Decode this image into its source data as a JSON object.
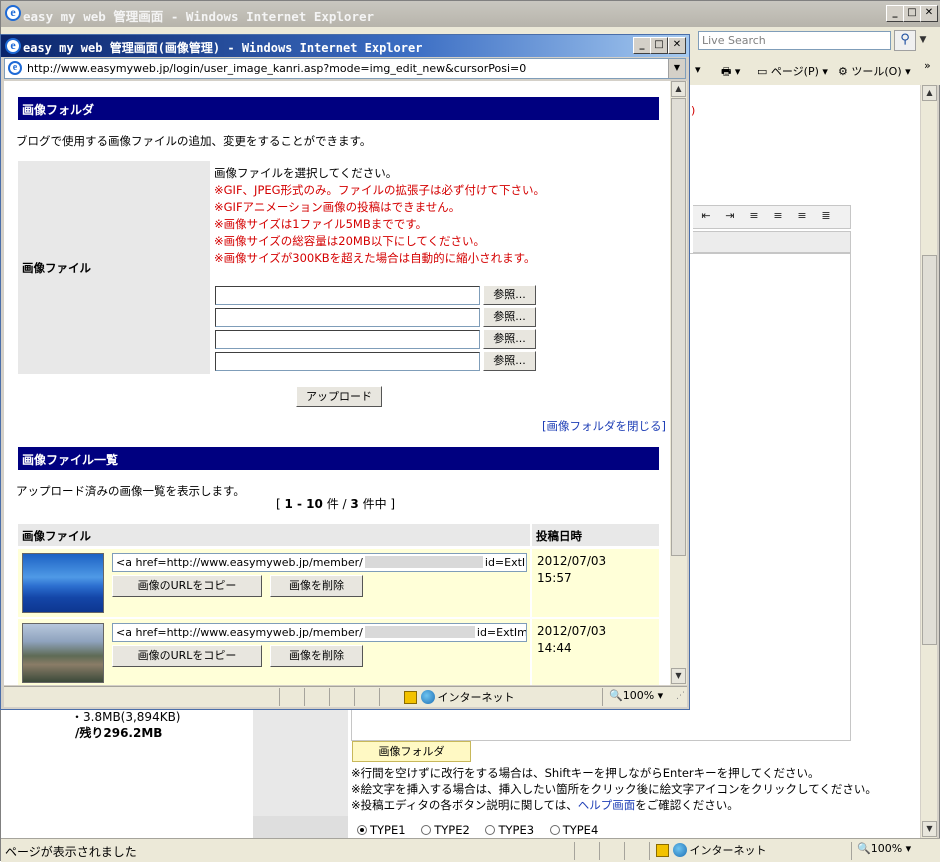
{
  "bg_window": {
    "title": "easy my web 管理画面 - Windows Internet Explorer",
    "search_placeholder": "Live Search",
    "cmd_page": "ページ(P)",
    "cmd_tools": "ツール(O)",
    "red_fragment": ")",
    "capacity": "・3.8MB(3,894KB)",
    "remaining": "/残り296.2MB",
    "folder_button": "画像フォルダ",
    "note1": "※行間を空けずに改行をする場合は、Shiftキーを押しながらEnterキーを押してください。",
    "note2": "※絵文字を挿入する場合は、挿入したい箇所をクリック後に絵文字アイコンをクリックしてください。",
    "note3_pre": "※投稿エディタの各ボタン説明に関しては、",
    "note3_link": "ヘルプ画面",
    "note3_post": "をご確認ください。",
    "types": [
      "TYPE1",
      "TYPE2",
      "TYPE3",
      "TYPE4"
    ],
    "status_text": "ページが表示されました",
    "status_zone": "インターネット",
    "status_zoom": "100%"
  },
  "popup": {
    "title": "easy my web 管理画面(画像管理) - Windows Internet Explorer",
    "url": "http://www.easymyweb.jp/login/user_image_kanri.asp?mode=img_edit_new&cursorPosi=0",
    "folder_header": "画像フォルダ",
    "folder_desc": "ブログで使用する画像ファイルの追加、変更をすることができます。",
    "file_label": "画像ファイル",
    "select_prompt": "画像ファイルを選択してください。",
    "rules": [
      "※GIF、JPEG形式のみ。ファイルの拡張子は必ず付けて下さい。",
      "※GIFアニメーション画像の投稿はできません。",
      "※画像サイズは1ファイル5MBまでです。",
      "※画像サイズの総容量は20MB以下にしてください。",
      "※画像サイズが300KBを超えた場合は自動的に縮小されます。"
    ],
    "browse_label": "参照...",
    "upload_label": "アップロード",
    "close_folder": "[画像フォルダを閉じる]",
    "list_header": "画像ファイル一覧",
    "list_desc": "アップロード済みの画像一覧を表示します。",
    "paging_prefix": "[ ",
    "paging_range": "1 - 10",
    "paging_mid": " 件 / ",
    "paging_total": "3",
    "paging_suffix": " 件中 ]",
    "col_file": "画像ファイル",
    "col_date": "投稿日時",
    "copy_label": "画像のURLをコピー",
    "delete_label": "画像を削除",
    "rows": [
      {
        "url_pre": "<a href=http://www.easymyweb.jp/member/",
        "url_post": "id=ExtIm",
        "date": "2012/07/03",
        "time": "15:57"
      },
      {
        "url_pre": "<a href=http://www.easymyweb.jp/member/",
        "url_post": "id=ExtIme",
        "date": "2012/07/03",
        "time": "14:44"
      }
    ],
    "status_zone": "インターネット",
    "status_zoom": "100%"
  }
}
